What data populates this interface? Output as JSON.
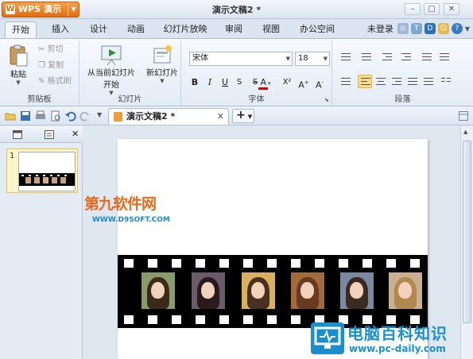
{
  "app": {
    "button_label": "WPS 演示",
    "document_title": "演示文稿2 *"
  },
  "tabs": [
    "开始",
    "插入",
    "设计",
    "动画",
    "幻灯片放映",
    "审阅",
    "视图",
    "办公空间"
  ],
  "active_tab": "开始",
  "account": {
    "login_label": "未登录"
  },
  "ribbon": {
    "clipboard": {
      "label": "剪贴板",
      "paste": "粘贴",
      "cut": "剪切",
      "copy": "复制",
      "format_painter": "格式刷"
    },
    "slides": {
      "label": "幻灯片",
      "play_from_current_line1": "从当前幻灯片",
      "play_from_current_line2": "开始",
      "new_slide": "新幻灯片"
    },
    "font": {
      "label": "字体",
      "font_name": "宋体",
      "font_size": "18"
    },
    "paragraph": {
      "label": "段落"
    }
  },
  "document_tab": {
    "title": "演示文稿2 *"
  },
  "slides_pane": {
    "slide_number": "1"
  },
  "watermarks": {
    "site1_name": "第九软件网",
    "site1_url": "WWW.D9SOFT.COM",
    "site2_name": "电脑百科知识",
    "site2_url": "www.pc-daily.com"
  },
  "colors": {
    "accent_orange": "#e06d10",
    "ribbon_blue": "#dbe5f1",
    "watermark_blue": "#1a8fcc"
  }
}
